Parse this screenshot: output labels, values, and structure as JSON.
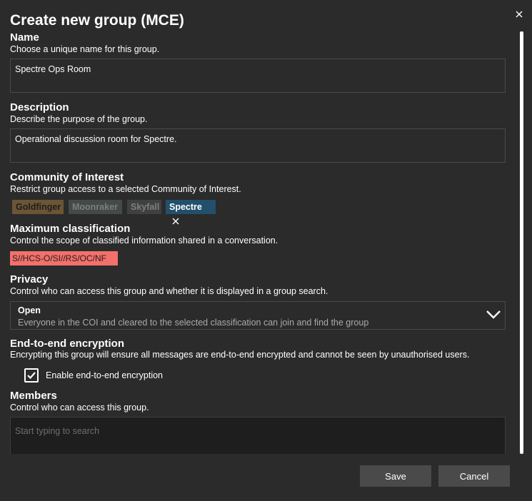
{
  "dialog": {
    "title": "Create new group (MCE)"
  },
  "name": {
    "title": "Name",
    "description": "Choose a unique name for this group.",
    "value": "Spectre Ops Room"
  },
  "description": {
    "title": "Description",
    "description": "Describe the purpose of the group.",
    "value": "Operational discussion room for Spectre."
  },
  "coi": {
    "title": "Community of Interest",
    "description": "Restrict group access to a selected Community of Interest.",
    "tags": [
      {
        "label": "Goldfinger",
        "color": "#6b5535"
      },
      {
        "label": "Moonraker",
        "color": "#444a48"
      },
      {
        "label": "Skyfall",
        "color": "#3f4140"
      },
      {
        "label": "Spectre",
        "color": "#22506b",
        "selected": true
      }
    ]
  },
  "classification": {
    "title": "Maximum classification",
    "description": "Control the scope of classified information shared in a conversation.",
    "value": "S//HCS-O/SI//RS/OC/NF",
    "color": "#f4706a"
  },
  "privacy": {
    "title": "Privacy",
    "description": "Control who can access this group and whether it is displayed in a group search.",
    "selected": "Open",
    "selected_description": "Everyone in the COI and cleared to the selected classification can join and find the group"
  },
  "encryption": {
    "title": "End-to-end encryption",
    "description": "Encrypting this group will ensure all messages are end-to-end encrypted and cannot be seen by unauthorised users.",
    "checkbox_label": "Enable end-to-end encryption",
    "checked": true
  },
  "members": {
    "title": "Members",
    "description": "Control who can access this group.",
    "placeholder": "Start typing to search"
  },
  "buttons": {
    "save": "Save",
    "cancel": "Cancel"
  }
}
